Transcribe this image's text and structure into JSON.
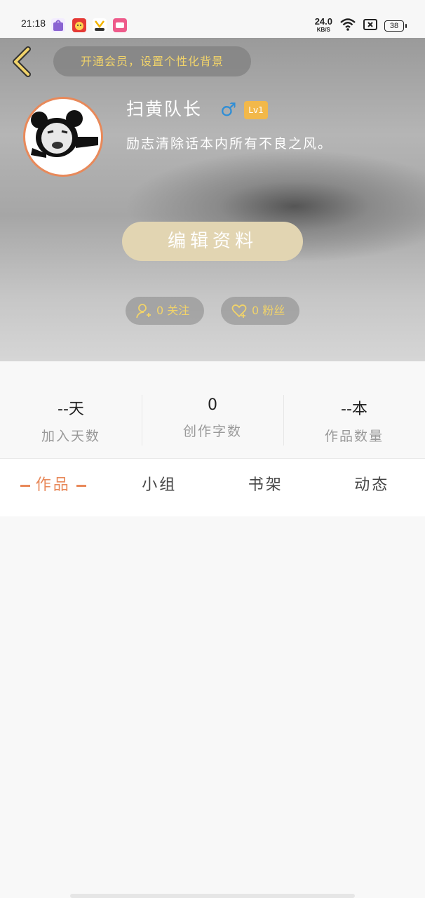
{
  "status_bar": {
    "time": "21:18",
    "speed_value": "24.0",
    "speed_unit": "KB/S",
    "battery": "38",
    "app_icons": [
      "shopping-bag-icon",
      "game-icon",
      "ugc-icon",
      "video-app-icon"
    ]
  },
  "header": {
    "vip_banner": "开通会员，设置个性化背景",
    "username": "扫黄队长",
    "gender_symbol": "♂",
    "level": "Lv1",
    "bio": "励志清除话本内所有不良之风。",
    "edit_button": "编辑资料",
    "following": "0 关注",
    "followers": "0 粉丝"
  },
  "stats": [
    {
      "value": "--天",
      "label": "加入天数"
    },
    {
      "value": "0",
      "label": "创作字数"
    },
    {
      "value": "--本",
      "label": "作品数量"
    }
  ],
  "tabs": [
    {
      "label": "作品"
    },
    {
      "label": "小组"
    },
    {
      "label": "书架"
    },
    {
      "label": "动态"
    }
  ],
  "colors": {
    "accent_orange": "#e8895a",
    "vip_yellow": "#f1d36a",
    "edit_button_bg": "#e2d5b2",
    "gender_blue": "#2f8ed6",
    "level_badge": "#f2b84a"
  }
}
